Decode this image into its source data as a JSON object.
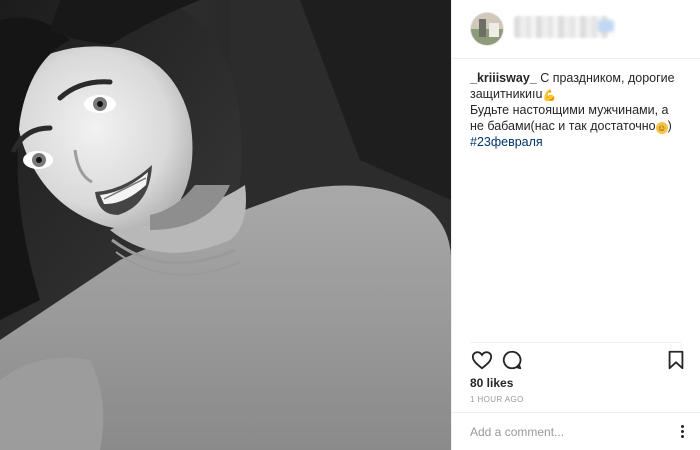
{
  "post": {
    "caption": {
      "username": "_kriiisway_",
      "text_line1": " С праздником, дорогие защитникиıu",
      "emoji1": "💪",
      "text_line2": "Будьте настоящими мужчинами, а не бабами(нас и так достаточно",
      "emoji2": "😁",
      "text_line2_end": ")",
      "hashtag": "#23февраля"
    },
    "actions": {
      "like_icon": "heart-icon",
      "comment_icon": "comment-bubble-icon",
      "save_icon": "bookmark-icon"
    },
    "likes": "80 likes",
    "timestamp": "1 HOUR AGO",
    "comment_box": {
      "placeholder": "Add a comment...",
      "value": ""
    },
    "colors": {
      "text": "#262626",
      "hashtag": "#003569",
      "muted": "#999999",
      "divider": "#efefef"
    }
  }
}
